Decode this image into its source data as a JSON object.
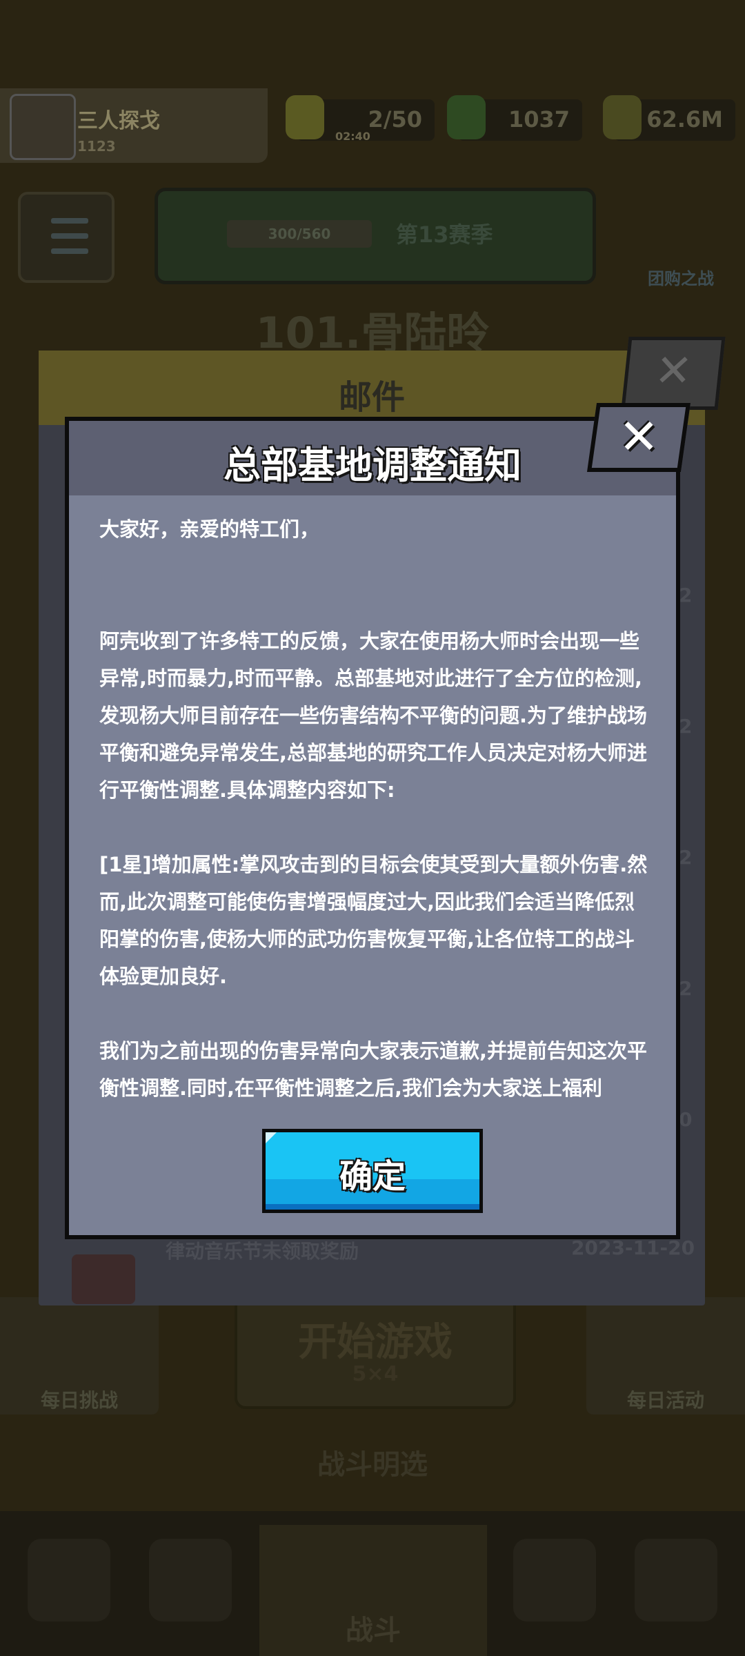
{
  "background": {
    "player": {
      "name": "三人探戈",
      "id": "1123"
    },
    "resources": [
      {
        "value": "2/50",
        "sub": "02:40",
        "icon": "energy-icon"
      },
      {
        "value": "1037",
        "icon": "gem-icon"
      },
      {
        "value": "62.6M",
        "icon": "coin-icon"
      }
    ],
    "season": {
      "progress": "300/560",
      "label": "第13赛季"
    },
    "shield_label": "团购之战",
    "stage_title": "101.骨陆昤",
    "bottom": {
      "left_label": "每日挑战",
      "start_label": "开始游戏",
      "start_sub": "5×4",
      "right_label": "每日活动",
      "mode_label": "战斗明选",
      "center_tab_label": "战斗"
    },
    "mail": {
      "title": "邮件",
      "row_label": "律动音乐节未领取奖励",
      "row_date": "2023-11-20",
      "side_nums": [
        "2",
        "2",
        "2",
        "2",
        "0"
      ]
    }
  },
  "modal": {
    "title": "总部基地调整通知",
    "paragraphs": [
      "大家好，亲爱的特工们，",
      "阿壳收到了许多特工的反馈，大家在使用杨大师时会出现一些异常,时而暴力,时而平静。总部基地对此进行了全方位的检测,发现杨大师目前存在一些伤害结构不平衡的问题.为了维护战场平衡和避免异常发生,总部基地的研究工作人员决定对杨大师进行平衡性调整.具体调整内容如下:",
      "[1星]增加属性:掌风攻击到的目标会使其受到大量额外伤害.然而,此次调整可能使伤害增强幅度过大,因此我们会适当降低烈阳掌的伤害,使杨大师的武功伤害恢复平衡,让各位特工的战斗体验更加良好.",
      "我们为之前出现的伤害异常向大家表示道歉,并提前告知这次平衡性调整.同时,在平衡性调整之后,我们会为大家送上福利"
    ],
    "close_label": "✕",
    "confirm_label": "确定"
  }
}
